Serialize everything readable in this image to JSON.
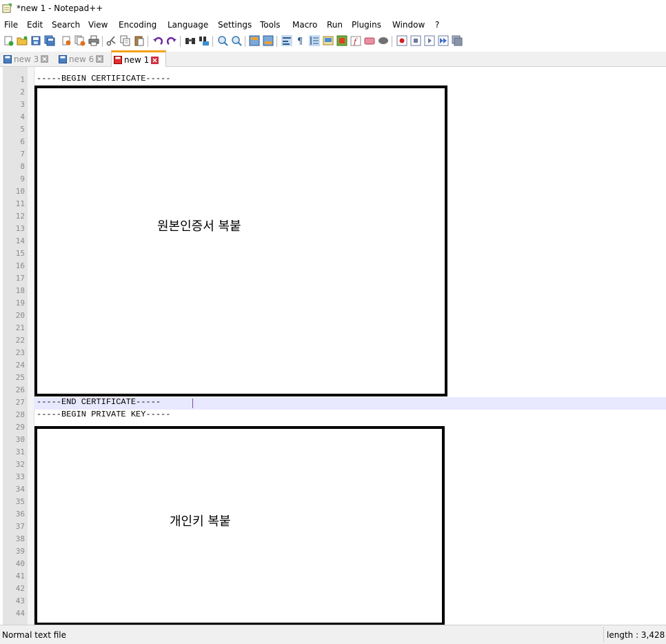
{
  "window": {
    "title": "*new 1 - Notepad++"
  },
  "menu": [
    "File",
    "Edit",
    "Search",
    "View",
    "Encoding",
    "Language",
    "Settings",
    "Tools",
    "Macro",
    "Run",
    "Plugins",
    "Window",
    "?"
  ],
  "toolbar": {
    "icons": [
      "new-file-icon",
      "open-file-icon",
      "save-icon",
      "save-all-icon",
      "close-icon",
      "close-all-icon",
      "print-icon",
      "cut-icon",
      "copy-icon",
      "paste-icon",
      "undo-icon",
      "redo-icon",
      "find-icon",
      "replace-icon",
      "zoom-in-icon",
      "zoom-out-icon",
      "sync-vertical-icon",
      "sync-horizontal-icon",
      "word-wrap-icon",
      "show-all-chars-icon",
      "indent-guide-icon",
      "doc-map-icon",
      "function-list-icon",
      "folder-workspace-icon",
      "monitoring-icon",
      "record-macro-icon",
      "stop-record-icon",
      "play-macro-icon",
      "run-macro-multiple-icon",
      "save-macro-icon"
    ]
  },
  "tabs": [
    {
      "label": "new 3",
      "active": false
    },
    {
      "label": "new 6",
      "active": false
    },
    {
      "label": "new 1",
      "active": true
    }
  ],
  "editor": {
    "line_numbers": [
      "1",
      "2",
      "3",
      "4",
      "5",
      "6",
      "7",
      "8",
      "9",
      "10",
      "11",
      "12",
      "13",
      "14",
      "15",
      "16",
      "17",
      "18",
      "19",
      "20",
      "21",
      "22",
      "23",
      "24",
      "25",
      "26",
      "27",
      "28",
      "29",
      "30",
      "31",
      "32",
      "33",
      "34",
      "35",
      "36",
      "37",
      "38",
      "39",
      "40",
      "41",
      "42",
      "43",
      "44"
    ],
    "line1": "-----BEGIN CERTIFICATE-----",
    "line27": "-----END CERTIFICATE-----",
    "line28": "-----BEGIN PRIVATE KEY-----",
    "cert_box_label": "원본인증서 복붙",
    "key_box_label": "개인키 복붙"
  },
  "status": {
    "file_type": "Normal text file",
    "length": "length : 3,428"
  },
  "colors": {
    "active_tab_accent": "#f4a11c",
    "current_line": "#e8e8ff",
    "gutter": "#e4e4e4"
  }
}
